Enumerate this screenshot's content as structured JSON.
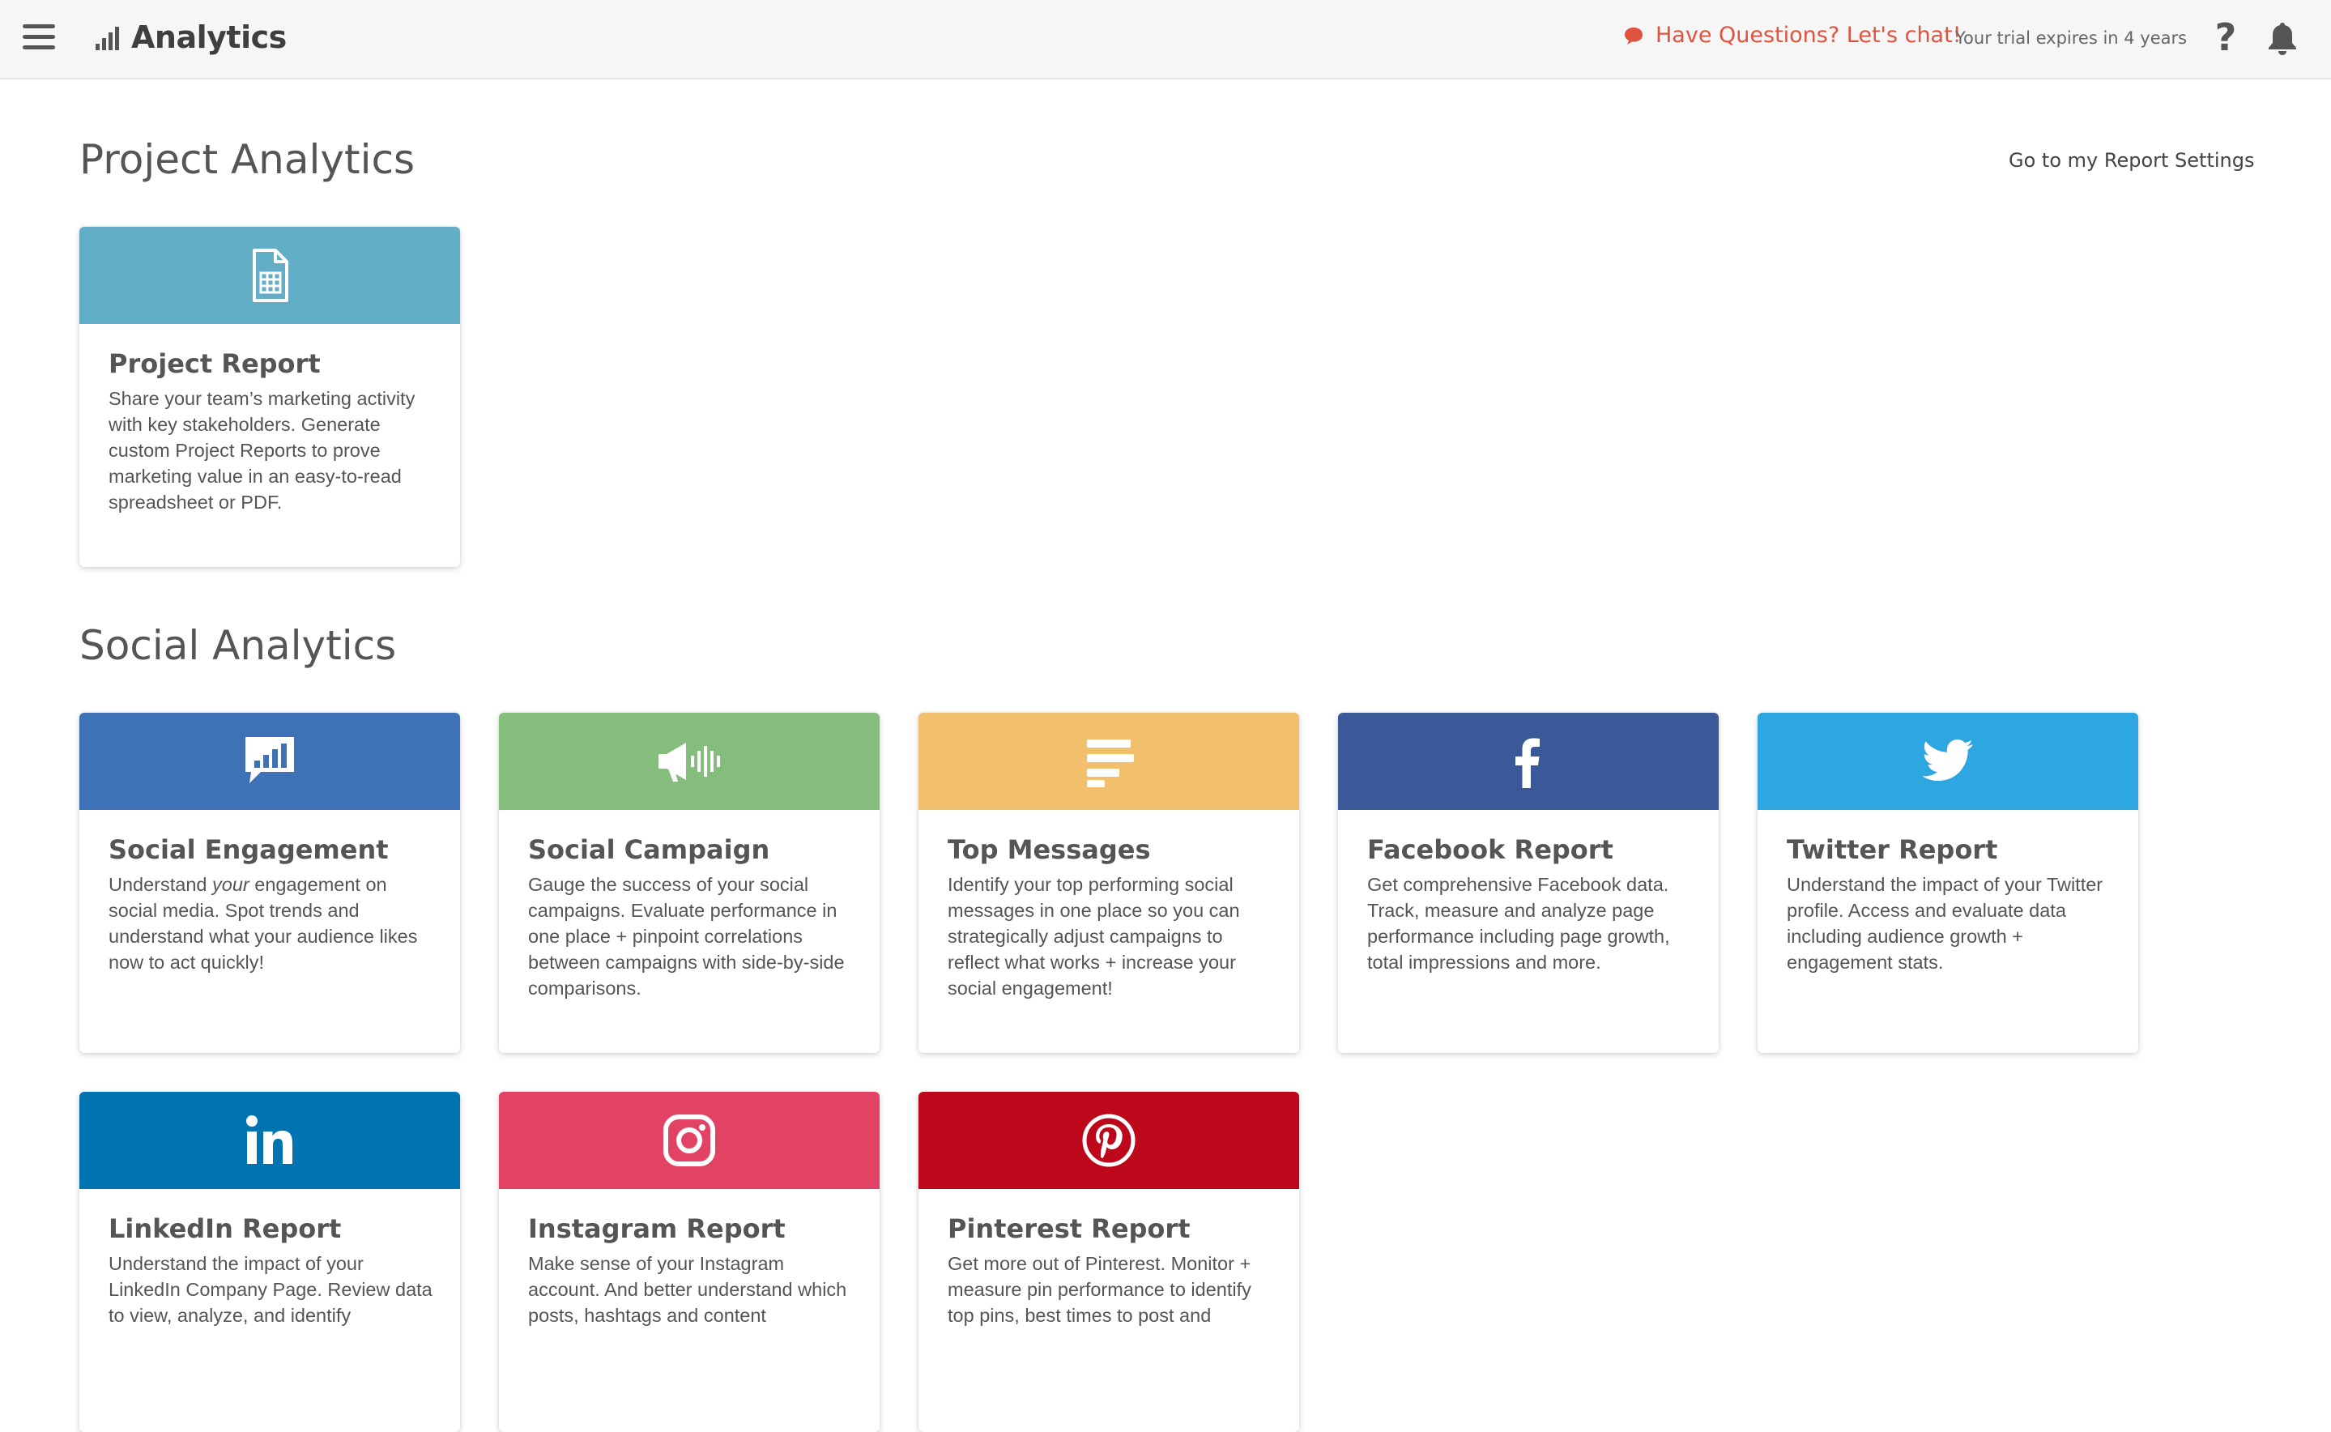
{
  "header": {
    "app_title": "Analytics",
    "chat_label": "Have Questions? Let's chat!",
    "trial_text": "Your trial expires in 4 years",
    "help_label": "?"
  },
  "project_section": {
    "title": "Project Analytics",
    "settings_link": "Go to my Report Settings"
  },
  "social_section": {
    "title": "Social Analytics"
  },
  "cards": {
    "project_report": {
      "title": "Project Report",
      "desc": "Share your team’s marketing activity with key stakeholders. Generate custom Project Reports to prove marketing value in an easy-to-read spreadsheet or PDF.",
      "color": "#62aec7",
      "icon": "spreadsheet-icon"
    },
    "social_engagement": {
      "title": "Social Engagement",
      "desc_before": "Understand ",
      "desc_em": "your",
      "desc_after": " engagement on social media. Spot trends and understand what your audience likes now to act quickly!",
      "color": "#3e72b7",
      "icon": "chat-chart-icon"
    },
    "social_campaign": {
      "title": "Social Campaign",
      "desc": "Gauge the success of your social campaigns. Evaluate performance in one place + pinpoint correlations between campaigns with side-by-side comparisons.",
      "color": "#84bd7c",
      "icon": "megaphone-icon"
    },
    "top_messages": {
      "title": "Top Messages",
      "desc": "Identify your top performing social messages in one place so you can strategically adjust campaigns to reflect what works + increase your social engagement!",
      "color": "#f2c06c",
      "icon": "ranking-bars-icon"
    },
    "facebook_report": {
      "title": "Facebook Report",
      "desc": "Get comprehensive Facebook data. Track, measure and analyze page performance including page growth, total impressions and more.",
      "color": "#3b5898",
      "icon": "facebook-icon"
    },
    "twitter_report": {
      "title": "Twitter Report",
      "desc": "Understand the impact of your Twitter profile. Access and evaluate data including audience growth + engagement stats.",
      "color": "#2ea6e1",
      "icon": "twitter-icon"
    },
    "linkedin_report": {
      "title": "LinkedIn Report",
      "desc": "Understand the impact of your LinkedIn Company Page. Review data to view, analyze, and identify",
      "color": "#0073b1",
      "icon": "linkedin-icon"
    },
    "instagram_report": {
      "title": "Instagram Report",
      "desc": "Make sense of your Instagram account. And better understand which posts, hashtags and content",
      "color": "#e24263",
      "icon": "instagram-icon"
    },
    "pinterest_report": {
      "title": "Pinterest Report",
      "desc": "Get more out of Pinterest. Monitor + measure pin performance to identify top pins, best times to post and",
      "color": "#bd081c",
      "icon": "pinterest-icon"
    }
  }
}
